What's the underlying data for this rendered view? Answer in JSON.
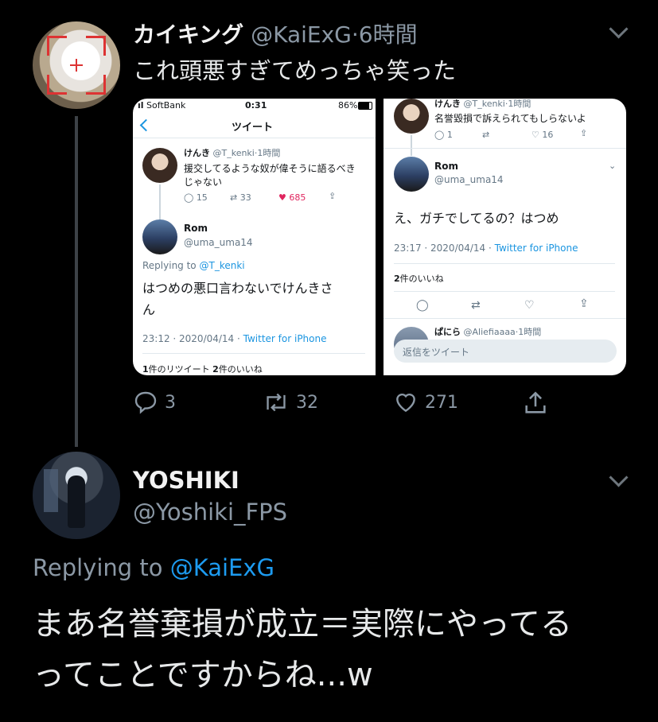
{
  "tweet1": {
    "display_name": "カイキング",
    "handle": "@KaiExG",
    "time": "6時間",
    "text": "これ頭悪すぎてめっちゃ笑った",
    "actions": {
      "replies": "3",
      "retweets": "32",
      "likes": "271"
    }
  },
  "media": {
    "left": {
      "status_bar": {
        "carrier": "SoftBank",
        "time": "0:31",
        "battery": "86%"
      },
      "nav_title": "ツイート",
      "tweet_a": {
        "name": "けんき",
        "handle": "@T_kenki",
        "time": "1時間",
        "text_line1": "援交してるような奴が偉そうに語るべき",
        "text_line2": "じゃない",
        "replies": "15",
        "retweets": "33",
        "likes": "685"
      },
      "tweet_b": {
        "name": "Rom",
        "handle": "@uma_uma14",
        "replying_label": "Replying to",
        "replying_handle": "@T_kenki",
        "text_line1": "はつめの悪口言わないでけんきさ",
        "text_line2": "ん",
        "timestamp": "23:12 · 2020/04/14 · ",
        "source": "Twitter for iPhone",
        "rt_count": "1",
        "rt_label": "件のリツイート",
        "like_count": "2",
        "like_label": "件のいいね"
      }
    },
    "right": {
      "tweet_a": {
        "name": "けんき",
        "handle": "@T_kenki",
        "time": "1時間",
        "text": "名誉毀損で訴えられてもしらないよ",
        "replies": "1",
        "likes": "16"
      },
      "tweet_b": {
        "name": "Rom",
        "handle": "@uma_uma14",
        "text": "え、ガチでしてるの？はつめ",
        "timestamp": "23:17 · 2020/04/14 · ",
        "source": "Twitter for iPhone",
        "like_count": "2",
        "like_label": "件のいいね"
      },
      "tweet_c": {
        "name": "ぱにら",
        "handle": "@Aliefiaaaa",
        "time": "1時間"
      },
      "reply_placeholder": "返信をツイート"
    }
  },
  "tweet2": {
    "display_name": "YOSHIKI",
    "handle": "@Yoshiki_FPS",
    "replying_label": "Replying to",
    "replying_handle": "@KaiExG",
    "text_line1": "まあ名誉棄損が成立＝実際にやってる",
    "text_line2": "ってことですからね...w"
  },
  "icons": [
    "chevron-down-icon",
    "reply-icon",
    "retweet-icon",
    "like-icon",
    "share-icon",
    "back-icon",
    "battery-icon",
    "wifi-icon"
  ],
  "colors": {
    "background": "#000000",
    "link": "#1d9bf0",
    "muted": "#8b98a5",
    "heart": "#e0245e"
  }
}
